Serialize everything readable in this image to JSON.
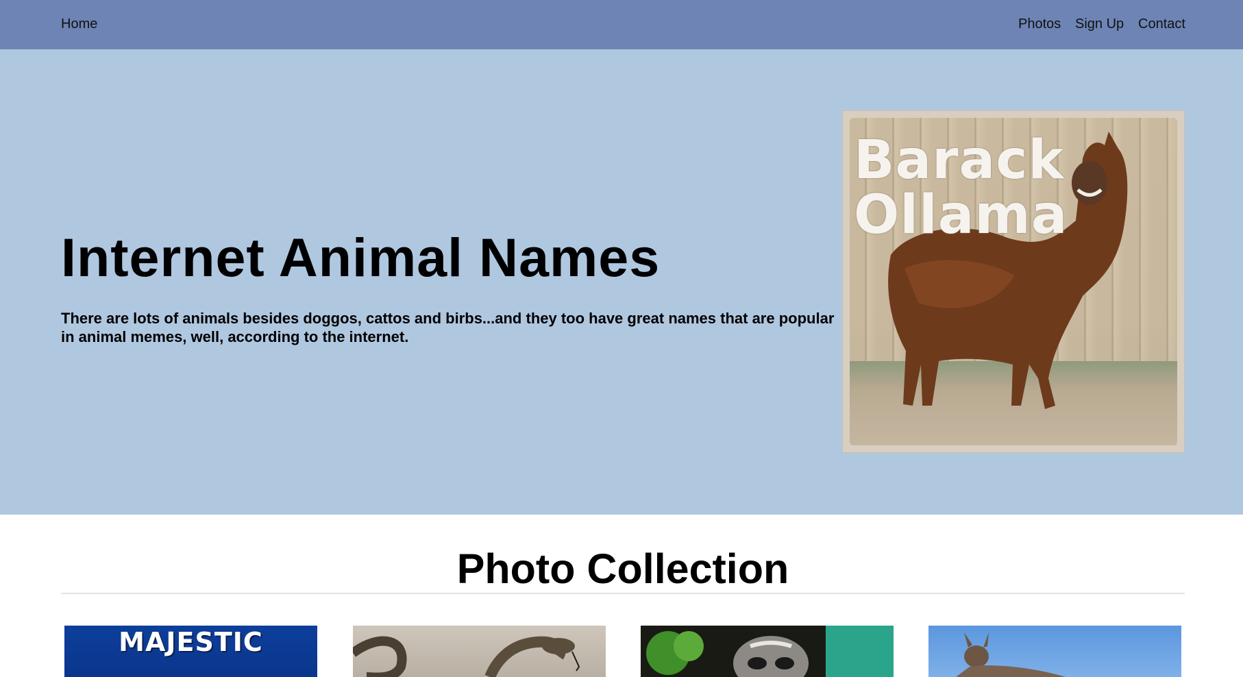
{
  "nav": {
    "home": "Home",
    "photos": "Photos",
    "signup": "Sign Up",
    "contact": "Contact",
    "background_color": "#6d84b5"
  },
  "hero": {
    "title": "Internet Animal Names",
    "text": "There are lots of animals besides doggos, cattos and birbs...and they too have great names that are popular in animal memes, well, according to the internet.",
    "background_color": "#b0c7e0",
    "image": {
      "caption_line1": "Barack",
      "caption_line2": "Ollama",
      "subject": "llama-meme-photo"
    }
  },
  "collection": {
    "title": "Photo Collection",
    "thumbnails": [
      {
        "subject": "majestic-meme-photo",
        "caption": "MAJESTIC"
      },
      {
        "subject": "snake-photo",
        "caption": ""
      },
      {
        "subject": "raccoon-photo",
        "caption": ""
      },
      {
        "subject": "kangaroo-photo",
        "caption": ""
      }
    ]
  }
}
